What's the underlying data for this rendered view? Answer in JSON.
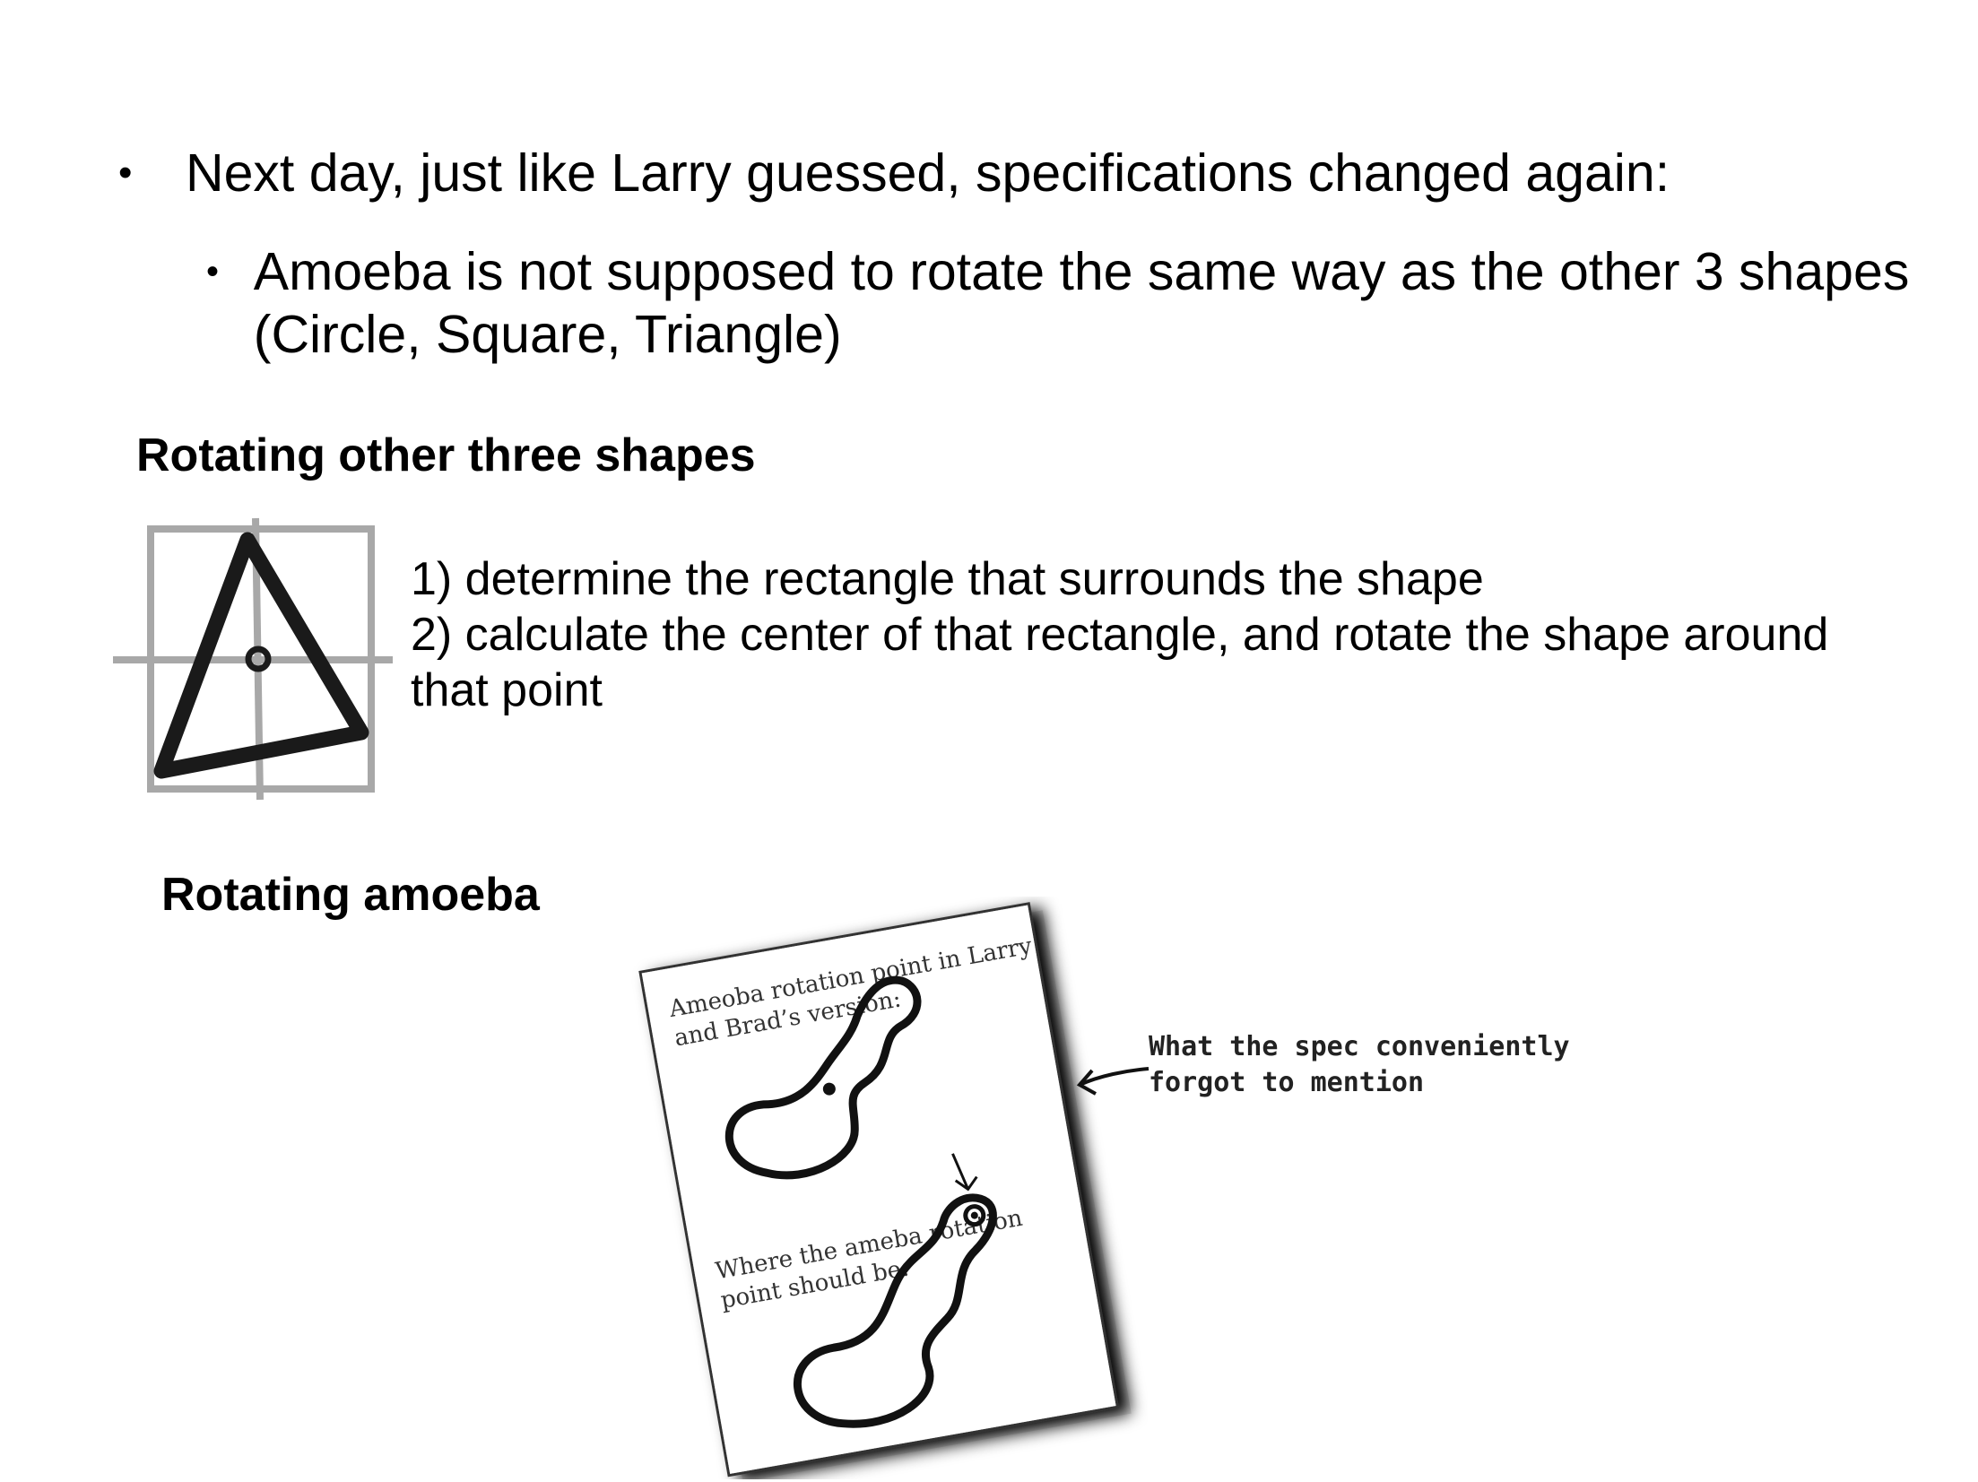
{
  "bullets": [
    {
      "text": "Next day, just like Larry guessed, specifications changed again:"
    },
    {
      "text": "Amoeba is not supposed to rotate the same way as the other 3 shapes (Circle, Square, Triangle)"
    }
  ],
  "bullet_glyph": "•",
  "section_other": {
    "heading": "Rotating other three shapes",
    "steps": [
      "1) determine the rectangle that surrounds the shape",
      "2) calculate the center of that rectangle, and rotate the shape around",
      "that point"
    ]
  },
  "section_amoeba": {
    "heading": "Rotating amoeba",
    "card": {
      "top_caption": [
        "Ameoba rotation point in Larry",
        "and Brad’s version:"
      ],
      "bottom_caption": [
        "Where the ameba rotation",
        "point should be:"
      ]
    },
    "note": [
      "What the spec conveniently",
      "forgot to mention"
    ]
  },
  "icons": [
    "triangle-bounding-box-icon",
    "amoeba-shape-icon",
    "arrow-left-icon",
    "arrow-down-icon"
  ]
}
